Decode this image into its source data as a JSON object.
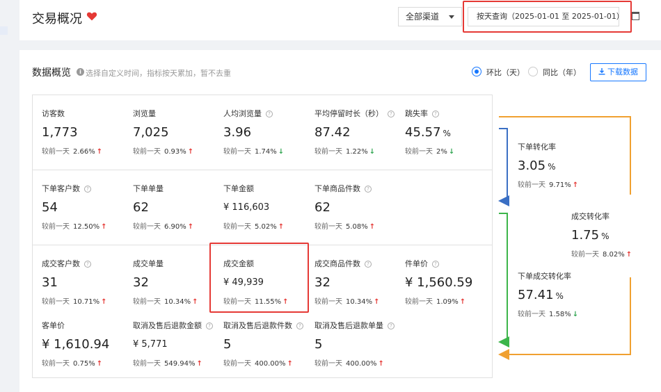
{
  "header": {
    "title": "交易概况",
    "channel": "全部渠道",
    "date_query": "按天查询（2025-01-01 至 2025-01-01）"
  },
  "section": {
    "title": "数据概览",
    "hint": "选择自定义时间，指标按天累加，暂不去重",
    "radio_day": "环比（天）",
    "radio_year": "同比（年）",
    "download": "下载数据"
  },
  "compare_prefix": "较前一天",
  "rows": [
    [
      {
        "label": "访客数",
        "value": "1,773",
        "pct": "2.66%",
        "trend": "up"
      },
      {
        "label": "浏览量",
        "value": "7,025",
        "pct": "0.93%",
        "trend": "up"
      },
      {
        "label": "人均浏览量",
        "help": true,
        "value": "3.96",
        "pct": "1.74%",
        "trend": "down"
      },
      {
        "label": "平均停留时长（秒）",
        "help": true,
        "value": "87.42",
        "pct": "1.22%",
        "trend": "down"
      },
      {
        "label": "跳失率",
        "help": true,
        "value": "45.57",
        "unit": "%",
        "pct": "2%",
        "trend": "down"
      }
    ],
    [
      {
        "label": "下单客户数",
        "help": true,
        "value": "54",
        "pct": "12.50%",
        "trend": "up"
      },
      {
        "label": "下单单量",
        "value": "62",
        "pct": "6.90%",
        "trend": "up"
      },
      {
        "label": "下单金额",
        "value": "¥ 116,603",
        "small": true,
        "pct": "5.02%",
        "trend": "up"
      },
      {
        "label": "下单商品件数",
        "help": true,
        "value": "62",
        "pct": "5.08%",
        "trend": "up"
      }
    ],
    [
      {
        "label": "成交客户数",
        "help": true,
        "value": "31",
        "pct": "10.71%",
        "trend": "up"
      },
      {
        "label": "成交单量",
        "value": "32",
        "pct": "10.34%",
        "trend": "up"
      },
      {
        "label": "成交金额",
        "value": "¥ 49,939",
        "small": true,
        "pct": "11.55%",
        "trend": "up"
      },
      {
        "label": "成交商品件数",
        "help": true,
        "value": "32",
        "pct": "10.34%",
        "trend": "up"
      },
      {
        "label": "件单价",
        "help": true,
        "value": "¥ 1,560.59",
        "pct": "1.09%",
        "trend": "up"
      }
    ],
    [
      {
        "label": "客单价",
        "value": "¥ 1,610.94",
        "pct": "0.75%",
        "trend": "up"
      },
      {
        "label": "取消及售后退款金额",
        "help": true,
        "value": "¥ 5,771",
        "small": true,
        "pct": "549.94%",
        "trend": "up"
      },
      {
        "label": "取消及售后退款件数",
        "help": true,
        "value": "5",
        "pct": "400.00%",
        "trend": "up"
      },
      {
        "label": "取消及售后退款单量",
        "help": true,
        "value": "5",
        "pct": "400.00%",
        "trend": "up"
      }
    ]
  ],
  "conversions": [
    {
      "label": "下单转化率",
      "value": "3.05",
      "unit": "%",
      "pct": "9.71%",
      "trend": "up"
    },
    {
      "label": "成交转化率",
      "value": "1.75",
      "unit": "%",
      "pct": "8.02%",
      "trend": "up"
    },
    {
      "label": "下单成交转化率",
      "value": "57.41",
      "unit": "%",
      "pct": "1.58%",
      "trend": "down"
    }
  ],
  "colors": {
    "accent": "#1677ff",
    "up": "#e53935",
    "down": "#2ea44f",
    "flow_orange": "#f0a030",
    "flow_blue": "#3a6fc4",
    "flow_green": "#3cb54a"
  }
}
